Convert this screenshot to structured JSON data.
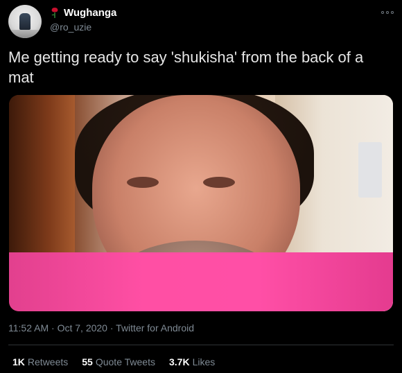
{
  "author": {
    "display_name": "Wughanga",
    "handle": "@ro_uzie",
    "badge_icon": "rose-icon",
    "avatar_icon": "avatar-photo"
  },
  "tweet": {
    "text": "Me getting ready to say 'shukisha' from the back of a mat",
    "time": "11:52 AM",
    "date": "Oct 7, 2020",
    "source": "Twitter for Android",
    "separator": "·"
  },
  "stats": {
    "retweets_count": "1K",
    "retweets_label": "Retweets",
    "quote_count": "55",
    "quote_label": "Quote Tweets",
    "likes_count": "3.7K",
    "likes_label": "Likes"
  },
  "menu": {
    "icon": "more-options-icon"
  },
  "colors": {
    "background": "#000000",
    "text": "#e7e7e7",
    "secondary": "#7f8a94",
    "divider": "#2f3336",
    "shirt": "#ff4fa4",
    "rose": "#c8102e"
  }
}
